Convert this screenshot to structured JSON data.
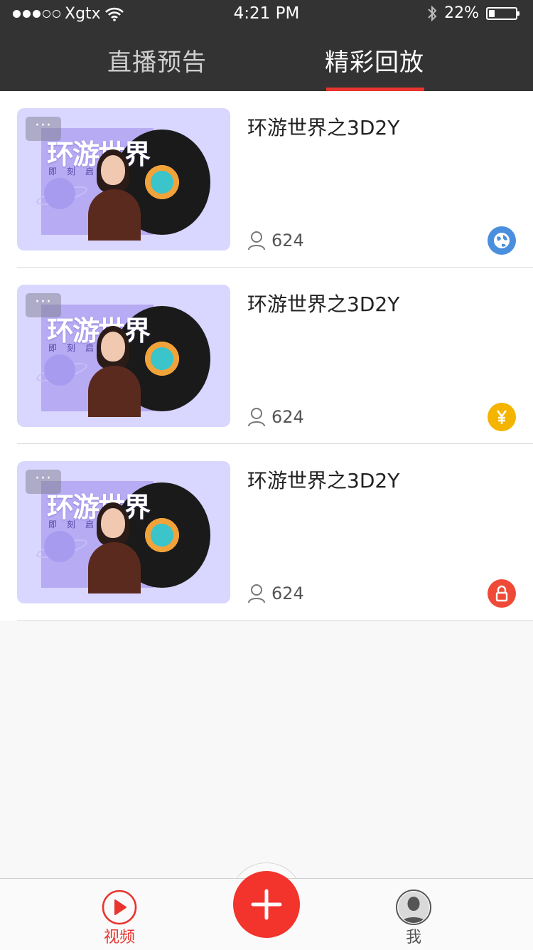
{
  "status_bar": {
    "carrier": "Xgtx",
    "time": "4:21 PM",
    "battery": "22%",
    "battery_level": 0.22
  },
  "tabs": [
    {
      "label": "直播预告",
      "active": false
    },
    {
      "label": "精彩回放",
      "active": true
    }
  ],
  "items": [
    {
      "title": "环游世界之3D2Y",
      "viewers": "624",
      "badge": "globe-icon",
      "badge_color": "#4a8fde",
      "thumb": {
        "title": "环游世界",
        "subtitle": "即刻启程",
        "more": "···"
      }
    },
    {
      "title": "环游世界之3D2Y",
      "viewers": "624",
      "badge": "yen-icon",
      "badge_color": "#f4b400",
      "thumb": {
        "title": "环游世界",
        "subtitle": "即刻启程",
        "more": "···"
      }
    },
    {
      "title": "环游世界之3D2Y",
      "viewers": "624",
      "badge": "lock-icon",
      "badge_color": "#ef4a37",
      "thumb": {
        "title": "环游世界",
        "subtitle": "即刻启程",
        "more": "···"
      }
    }
  ],
  "tabbar": {
    "video_label": "视频",
    "me_label": "我"
  },
  "colors": {
    "header": "#333333",
    "accent": "#e8352e"
  }
}
